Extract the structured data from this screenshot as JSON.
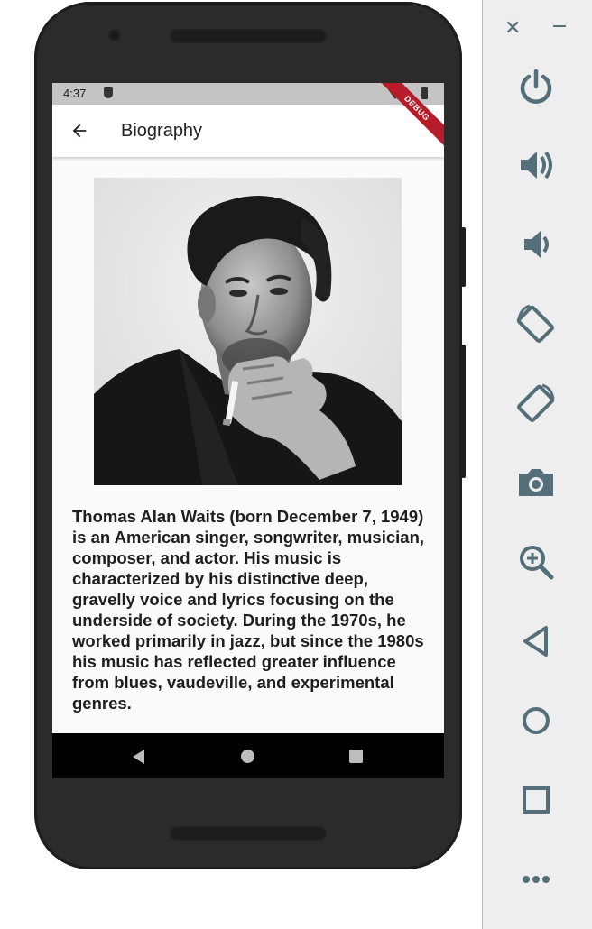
{
  "status_bar": {
    "time": "4:37"
  },
  "debug_banner": "DEBUG",
  "app_bar": {
    "title": "Biography",
    "back_icon": "arrow-back-icon"
  },
  "bio_text": "Thomas Alan Waits (born December 7, 1949) is an American singer, songwriter, musician, composer, and actor. His music is characterized by his distinctive deep, gravelly voice and lyrics focusing on the underside of society. During the 1970s, he worked primarily in jazz, but since the 1980s his music has reflected greater influence from blues, vaudeville, and experimental genres.",
  "nav_bar": [
    "back-triangle-icon",
    "home-circle-icon",
    "recents-square-icon"
  ],
  "emulator_controls": [
    "close-icon",
    "minimize-icon",
    "power-icon",
    "volume-up-icon",
    "volume-down-icon",
    "rotate-left-icon",
    "rotate-right-icon",
    "camera-icon",
    "zoom-icon",
    "back-icon",
    "home-icon",
    "overview-icon",
    "more-icon"
  ],
  "colors": {
    "sidebar_icon": "#546e7a",
    "debug_banner": "#b71c2b",
    "status_bar": "#c4c4c4"
  }
}
